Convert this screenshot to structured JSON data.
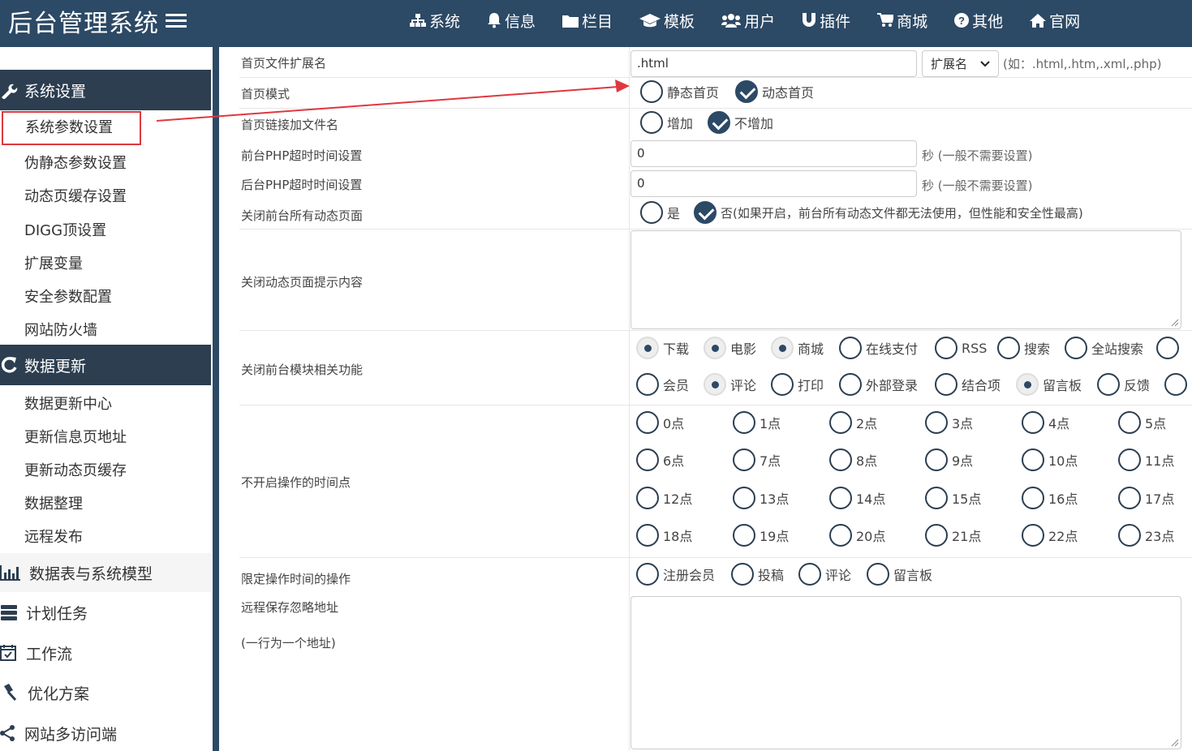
{
  "app": {
    "title": "后台管理系统"
  },
  "nav": [
    {
      "label": "系统",
      "icon": "sitemap-icon"
    },
    {
      "label": "信息",
      "icon": "bell-icon"
    },
    {
      "label": "栏目",
      "icon": "folder-icon"
    },
    {
      "label": "模板",
      "icon": "graduation-cap-icon"
    },
    {
      "label": "用户",
      "icon": "users-icon"
    },
    {
      "label": "插件",
      "icon": "magnet-icon"
    },
    {
      "label": "商城",
      "icon": "cart-icon"
    },
    {
      "label": "其他",
      "icon": "question-icon"
    },
    {
      "label": "官网",
      "icon": "home-icon"
    }
  ],
  "sidebar": {
    "group1": {
      "label": "系统设置",
      "icon": "wrench-icon",
      "items": [
        "系统参数设置",
        "伪静态参数设置",
        "动态页缓存设置",
        "DIGG顶设置",
        "扩展变量",
        "安全参数配置",
        "网站防火墙"
      ]
    },
    "group2": {
      "label": "数据更新",
      "icon": "refresh-icon",
      "items": [
        "数据更新中心",
        "更新信息页地址",
        "更新动态页缓存",
        "数据整理",
        "远程发布"
      ]
    },
    "sections": [
      {
        "label": "数据表与系统模型",
        "icon": "bar-chart-icon"
      },
      {
        "label": "计划任务",
        "icon": "tasks-icon"
      },
      {
        "label": "工作流",
        "icon": "calendar-icon"
      },
      {
        "label": "优化方案",
        "icon": "gavel-icon"
      },
      {
        "label": "网站多访问端",
        "icon": "share-icon"
      }
    ]
  },
  "form": {
    "ext": {
      "label": "首页文件扩展名",
      "value": ".html",
      "select": "扩展名",
      "hint": "(如：.html,.htm,.xml,.php)"
    },
    "mode": {
      "label": "首页模式",
      "options": [
        "静态首页",
        "动态首页"
      ],
      "selected": "动态首页"
    },
    "link": {
      "label": "首页链接加文件名",
      "options": [
        "增加",
        "不增加"
      ],
      "selected": "不增加"
    },
    "front_timeout": {
      "label": "前台PHP超时时间设置",
      "value": "0",
      "hint": "秒 (一般不需要设置)"
    },
    "back_timeout": {
      "label": "后台PHP超时时间设置",
      "value": "0",
      "hint": "秒 (一般不需要设置)"
    },
    "close_dynamic": {
      "label": "关闭前台所有动态页面",
      "options": [
        "是",
        "否(如果开启，前台所有动态文件都无法使用，但性能和安全性最高)"
      ],
      "selected": "否(如果开启，前台所有动态文件都无法使用，但性能和安全性最高)"
    },
    "close_tip": {
      "label": "关闭动态页面提示内容",
      "value": ""
    },
    "close_modules": {
      "label": "关闭前台模块相关功能",
      "row1": [
        "下载",
        "电影",
        "商城",
        "在线支付",
        "RSS",
        "搜索",
        "全站搜索"
      ],
      "row2": [
        "会员",
        "评论",
        "打印",
        "外部登录",
        "结合项",
        "留言板",
        "反馈"
      ],
      "checked": [
        "下载",
        "电影",
        "商城",
        "评论",
        "留言板"
      ]
    },
    "hours": {
      "label": "不开启操作的时间点",
      "values": [
        "0点",
        "1点",
        "2点",
        "3点",
        "4点",
        "5点",
        "6点",
        "7点",
        "8点",
        "9点",
        "10点",
        "11点",
        "12点",
        "13点",
        "14点",
        "15点",
        "16点",
        "17点",
        "18点",
        "19点",
        "20点",
        "21点",
        "22点",
        "23点"
      ]
    },
    "limit_ops": {
      "label": "限定操作时间的操作",
      "options": [
        "注册会员",
        "投稿",
        "评论",
        "留言板"
      ]
    },
    "remote_ignore": {
      "label": "远程保存忽略地址",
      "sublabel": "(一行为一个地址)",
      "value": ""
    }
  },
  "colors": {
    "header": "#2c4965",
    "sidebar_group": "#2c3e50",
    "highlight": "#e0383f"
  }
}
